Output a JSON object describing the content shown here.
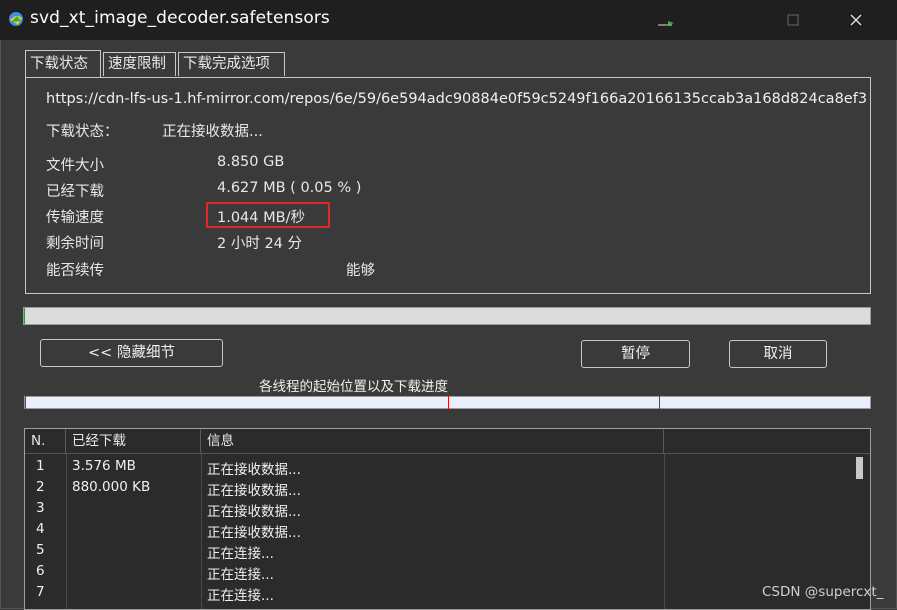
{
  "window": {
    "title": "svd_xt_image_decoder.safetensors",
    "icon": "downloader-app-icon",
    "controls": {
      "minimize": "—",
      "maximize": "☐",
      "close": "✕"
    }
  },
  "tabs": [
    {
      "label": "下载状态",
      "active": true
    },
    {
      "label": "速度限制",
      "active": false
    },
    {
      "label": "下载完成选项",
      "active": false
    }
  ],
  "status": {
    "url": "https://cdn-lfs-us-1.hf-mirror.com/repos/6e/59/6e594adc90884e0f59c5249f166a20166135ccab3a168d824ca8ef3",
    "state_label": "下载状态：",
    "state_value": "正在接收数据...",
    "file_size_label": "文件大小",
    "file_size_value": "8.850  GB",
    "downloaded_label": "已经下载",
    "downloaded_value": "4.627  MB  ( 0.05 % )",
    "speed_label": "传输速度",
    "speed_value": "1.044  MB/秒",
    "remaining_label": "剩余时间",
    "remaining_value": "2 小时 24 分",
    "resume_label": "能否续传",
    "resume_value": "能够"
  },
  "progress": {
    "fraction": 0.0005
  },
  "buttons": {
    "hide_details": "<< 隐藏细节",
    "pause": "暂停",
    "cancel": "取消"
  },
  "threads_caption": "各线程的起始位置以及下载进度",
  "threads_bar": {
    "segment_starts_fraction": [
      0.0,
      0.5,
      0.75
    ]
  },
  "table": {
    "headers": [
      "N.",
      "已经下载",
      "信息",
      ""
    ],
    "rows": [
      {
        "n": "1",
        "downloaded": "3.576  MB",
        "info": "正在接收数据..."
      },
      {
        "n": "2",
        "downloaded": "880.000  KB",
        "info": "正在接收数据..."
      },
      {
        "n": "3",
        "downloaded": "",
        "info": "正在接收数据..."
      },
      {
        "n": "4",
        "downloaded": "",
        "info": "正在接收数据..."
      },
      {
        "n": "5",
        "downloaded": "",
        "info": "正在连接..."
      },
      {
        "n": "6",
        "downloaded": "",
        "info": "正在连接..."
      },
      {
        "n": "7",
        "downloaded": "",
        "info": "正在连接..."
      }
    ]
  },
  "watermark": "CSDN @supercxt_",
  "colors": {
    "highlight": "#e0282a",
    "tick": "#d01515"
  }
}
